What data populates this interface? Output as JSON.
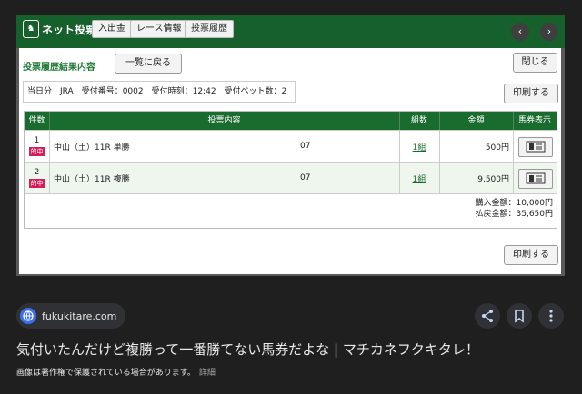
{
  "preview": {
    "brand": "ネット投票",
    "nav": [
      "入出金",
      "レース情報",
      "投票履歴"
    ],
    "nav_prev_icon": "chevron-left-icon",
    "nav_next_icon": "chevron-right-icon",
    "dialog": {
      "title": "投票履歴結果内容",
      "back_label": "一覧に戻る",
      "close_label": "閉じる",
      "info": "当日分　JRA　受付番号：0002　受付時刻：12:42　受付ベット数：2",
      "print_label": "印刷する",
      "table": {
        "headers": [
          "件数",
          "投票内容",
          "組数",
          "金額",
          "馬券表示"
        ],
        "rows": [
          {
            "num": "1",
            "badge": "的中",
            "race": "中山（土）11R 単勝",
            "horse": "07",
            "sets": "1組",
            "amount": "500円"
          },
          {
            "num": "2",
            "badge": "的中",
            "race": "中山（土）11R 複勝",
            "horse": "07",
            "sets": "1組",
            "amount": "9,500円"
          }
        ],
        "purchase_total": "購入金額：10,000円",
        "refund_total": "払戻金額：35,650円"
      }
    }
  },
  "source_site": "fukukitare.com",
  "actions": {
    "share_icon": "share-icon",
    "save_icon": "bookmark-icon",
    "more_icon": "more-vert-icon"
  },
  "page_title": "気付いたんだけど複勝って一番勝てない馬券だよな | マチカネフクキタレ！",
  "copyright_notice": "画像は著作権で保護されている場合があります。",
  "details_link": "詳細",
  "colors": {
    "header_green": "#16602c",
    "title_green": "#1d7a35",
    "hit_badge": "#d21e5a",
    "accent_blue": "#3b6ef0"
  }
}
